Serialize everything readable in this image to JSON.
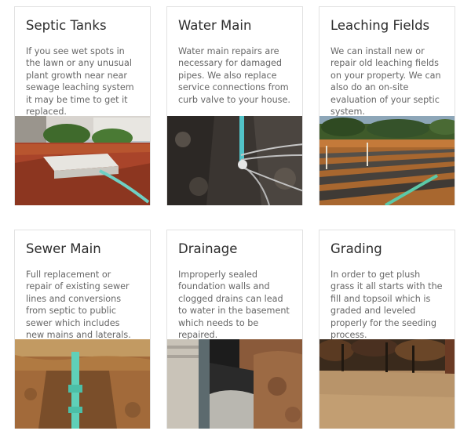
{
  "services": [
    {
      "title": "Septic Tanks",
      "description": "If you see wet spots in the lawn or any unusual plant growth near near sewage leaching system it may be time to get it replaced.",
      "photo": "septic-tank-photo"
    },
    {
      "title": "Water Main",
      "description": "Water main repairs are necessary for damaged pipes. We also replace service connections from curb valve to your house.",
      "photo": "water-main-photo"
    },
    {
      "title": "Leaching Fields",
      "description": "We can install new or repair old leaching fields on your property. We can also do an on-site evaluation of your septic system.",
      "photo": "leaching-field-photo"
    },
    {
      "title": "Sewer Main",
      "description": "Full replacement or repair of existing sewer lines and conversions from septic to public sewer which includes new mains and laterals.",
      "photo": "sewer-main-photo"
    },
    {
      "title": "Drainage",
      "description": "Improperly sealed foundation walls and clogged drains can lead to water in the basement which needs to be repaired.",
      "photo": "drainage-photo"
    },
    {
      "title": "Grading",
      "description": "In order to get plush grass it all starts with the fill and topsoil which is graded and leveled properly for the seeding process.",
      "photo": "grading-photo"
    }
  ]
}
